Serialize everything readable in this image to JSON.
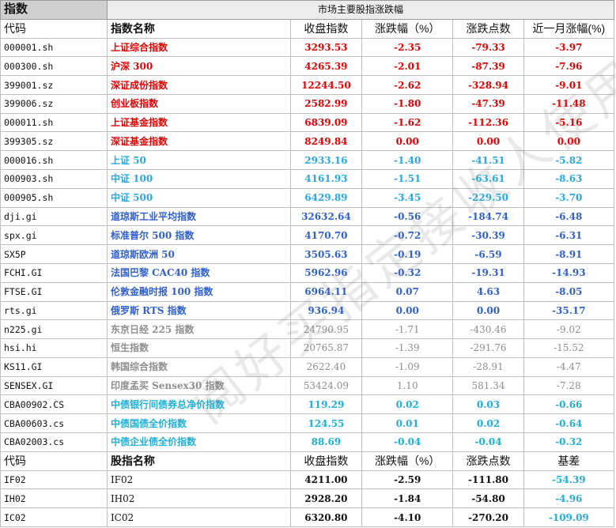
{
  "corner_label": "指数",
  "table_title": "市场主要股指涨跌幅",
  "header": {
    "code": "代码",
    "name": "指数名称",
    "close": "收盘指数",
    "change_pct": "涨跌幅（%）",
    "change_pts": "涨跌点数",
    "month_pct": "近一月涨幅(%)"
  },
  "rows": [
    {
      "code": "000001.sh",
      "name": "上证综合指数",
      "close": "3293.53",
      "change_pct": "-2.35",
      "change_pts": "-79.33",
      "month_pct": "-3.97",
      "color": "red"
    },
    {
      "code": "000300.sh",
      "name": "沪深 300",
      "close": "4265.39",
      "change_pct": "-2.01",
      "change_pts": "-87.39",
      "month_pct": "-7.96",
      "color": "red"
    },
    {
      "code": "399001.sz",
      "name": "深证成份指数",
      "close": "12244.50",
      "change_pct": "-2.62",
      "change_pts": "-328.94",
      "month_pct": "-9.01",
      "color": "red"
    },
    {
      "code": "399006.sz",
      "name": "创业板指数",
      "close": "2582.99",
      "change_pct": "-1.80",
      "change_pts": "-47.39",
      "month_pct": "-11.48",
      "color": "red"
    },
    {
      "code": "000011.sh",
      "name": "上证基金指数",
      "close": "6839.09",
      "change_pct": "-1.62",
      "change_pts": "-112.36",
      "month_pct": "-5.16",
      "color": "red"
    },
    {
      "code": "399305.sz",
      "name": "深证基金指数",
      "close": "8249.84",
      "change_pct": "0.00",
      "change_pts": "0.00",
      "month_pct": "0.00",
      "color": "red"
    },
    {
      "code": "000016.sh",
      "name": "上证 50",
      "close": "2933.16",
      "change_pct": "-1.40",
      "change_pts": "-41.51",
      "month_pct": "-5.82",
      "color": "cyan"
    },
    {
      "code": "000903.sh",
      "name": "中证 100",
      "close": "4161.93",
      "change_pct": "-1.51",
      "change_pts": "-63.61",
      "month_pct": "-8.63",
      "color": "cyan"
    },
    {
      "code": "000905.sh",
      "name": "中证 500",
      "close": "6429.89",
      "change_pct": "-3.45",
      "change_pts": "-229.50",
      "month_pct": "-3.70",
      "color": "cyan"
    },
    {
      "code": "dji.gi",
      "name": "道琼斯工业平均指数",
      "close": "32632.64",
      "change_pct": "-0.56",
      "change_pts": "-184.74",
      "month_pct": "-6.48",
      "color": "blue"
    },
    {
      "code": "spx.gi",
      "name": "标准普尔 500 指数",
      "close": "4170.70",
      "change_pct": "-0.72",
      "change_pts": "-30.39",
      "month_pct": "-6.31",
      "color": "blue"
    },
    {
      "code": "SX5P",
      "name": "道琼斯欧洲 50",
      "close": "3505.63",
      "change_pct": "-0.19",
      "change_pts": "-6.59",
      "month_pct": "-8.91",
      "color": "blue"
    },
    {
      "code": "FCHI.GI",
      "name": "法国巴黎 CAC40 指数",
      "close": "5962.96",
      "change_pct": "-0.32",
      "change_pts": "-19.31",
      "month_pct": "-14.93",
      "color": "blue"
    },
    {
      "code": "FTSE.GI",
      "name": "伦敦金融时报 100 指数",
      "close": "6964.11",
      "change_pct": "0.07",
      "change_pts": "4.63",
      "month_pct": "-8.05",
      "color": "blue"
    },
    {
      "code": "rts.gi",
      "name": "俄罗斯 RTS 指数",
      "close": "936.94",
      "change_pct": "0.00",
      "change_pts": "0.00",
      "month_pct": "-35.17",
      "color": "blue"
    },
    {
      "code": "n225.gi",
      "name": "东京日经 225 指数",
      "close": "24790.95",
      "change_pct": "-1.71",
      "change_pts": "-430.46",
      "month_pct": "-9.02",
      "color": "gray"
    },
    {
      "code": "hsi.hi",
      "name": "恒生指数",
      "close": "20765.87",
      "change_pct": "-1.39",
      "change_pts": "-291.76",
      "month_pct": "-15.52",
      "color": "gray"
    },
    {
      "code": "KS11.GI",
      "name": "韩国综合指数",
      "close": "2622.40",
      "change_pct": "-1.09",
      "change_pts": "-28.91",
      "month_pct": "-4.47",
      "color": "gray"
    },
    {
      "code": "SENSEX.GI",
      "name": "印度孟买 Sensex30 指数",
      "close": "53424.09",
      "change_pct": "1.10",
      "change_pts": "581.34",
      "month_pct": "-7.28",
      "color": "gray"
    },
    {
      "code": "CBA00902.CS",
      "name": "中债银行间债券总净价指数",
      "close": "119.29",
      "change_pct": "0.02",
      "change_pts": "0.03",
      "month_pct": "-0.66",
      "color": "teal"
    },
    {
      "code": "CBA00603.cs",
      "name": "中债国债全价指数",
      "close": "124.55",
      "change_pct": "0.01",
      "change_pts": "0.02",
      "month_pct": "-0.64",
      "color": "teal"
    },
    {
      "code": "CBA02003.cs",
      "name": "中债企业债全价指数",
      "close": "88.69",
      "change_pct": "-0.04",
      "change_pts": "-0.04",
      "month_pct": "-0.32",
      "color": "teal"
    }
  ],
  "futures_header": {
    "code": "代码",
    "name": "股指名称",
    "close": "收盘指数",
    "change_pct": "涨跌幅（%）",
    "change_pts": "涨跌点数",
    "basis": "基差"
  },
  "futures_rows": [
    {
      "code": "IF02",
      "name": "IF02",
      "close": "4211.00",
      "change_pct": "-2.59",
      "change_pts": "-111.80",
      "basis": "-54.39"
    },
    {
      "code": "IH02",
      "name": "IH02",
      "close": "2928.20",
      "change_pct": "-1.84",
      "change_pts": "-54.80",
      "basis": "-4.96"
    },
    {
      "code": "IC02",
      "name": "IC02",
      "close": "6320.80",
      "change_pct": "-4.10",
      "change_pts": "-270.20",
      "basis": "-109.09"
    }
  ],
  "colors": {
    "red": "#e60000",
    "cyan": "#26a9e6",
    "blue": "#2f5fd0",
    "gray": "#8e8e8e",
    "teal": "#1eb0d8",
    "basis": "#1eb0d8"
  },
  "watermark": "阅好买指定接收人使用"
}
